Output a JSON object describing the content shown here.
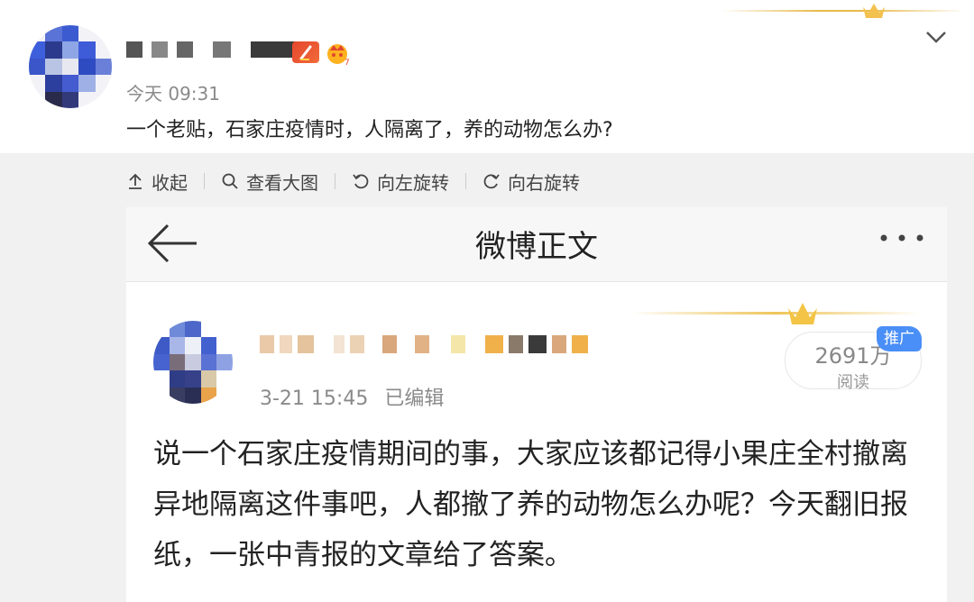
{
  "post": {
    "time": "今天 09:31",
    "text": "一个老贴，石家庄疫情时，人隔离了，养的动物怎么办?",
    "icons": [
      "vip-icon",
      "crown-level-icon",
      "chevron-down-icon"
    ]
  },
  "toolbar": {
    "collapse_label": "收起",
    "view_large_label": "查看大图",
    "rotate_left_label": "向左旋转",
    "rotate_right_label": "向右旋转"
  },
  "screenshot": {
    "header": {
      "title": "微博正文"
    },
    "card": {
      "time": "3-21 15:45",
      "edited": "已编辑",
      "reads_count": "2691万",
      "reads_label": "阅读",
      "promo_badge": "推广",
      "body_text": "说一个石家庄疫情期间的事，大家应该都记得小果庄全村撤离异地隔离这件事吧，人都撤了养的动物怎么办呢？今天翻旧报纸，一张中青报的文章给了答案。"
    }
  },
  "colors": {
    "accent_gold": "#e8b94a",
    "promo_blue": "#4a8ff7",
    "vip_red": "#e4472d",
    "muted_text": "#8a8a8a"
  }
}
